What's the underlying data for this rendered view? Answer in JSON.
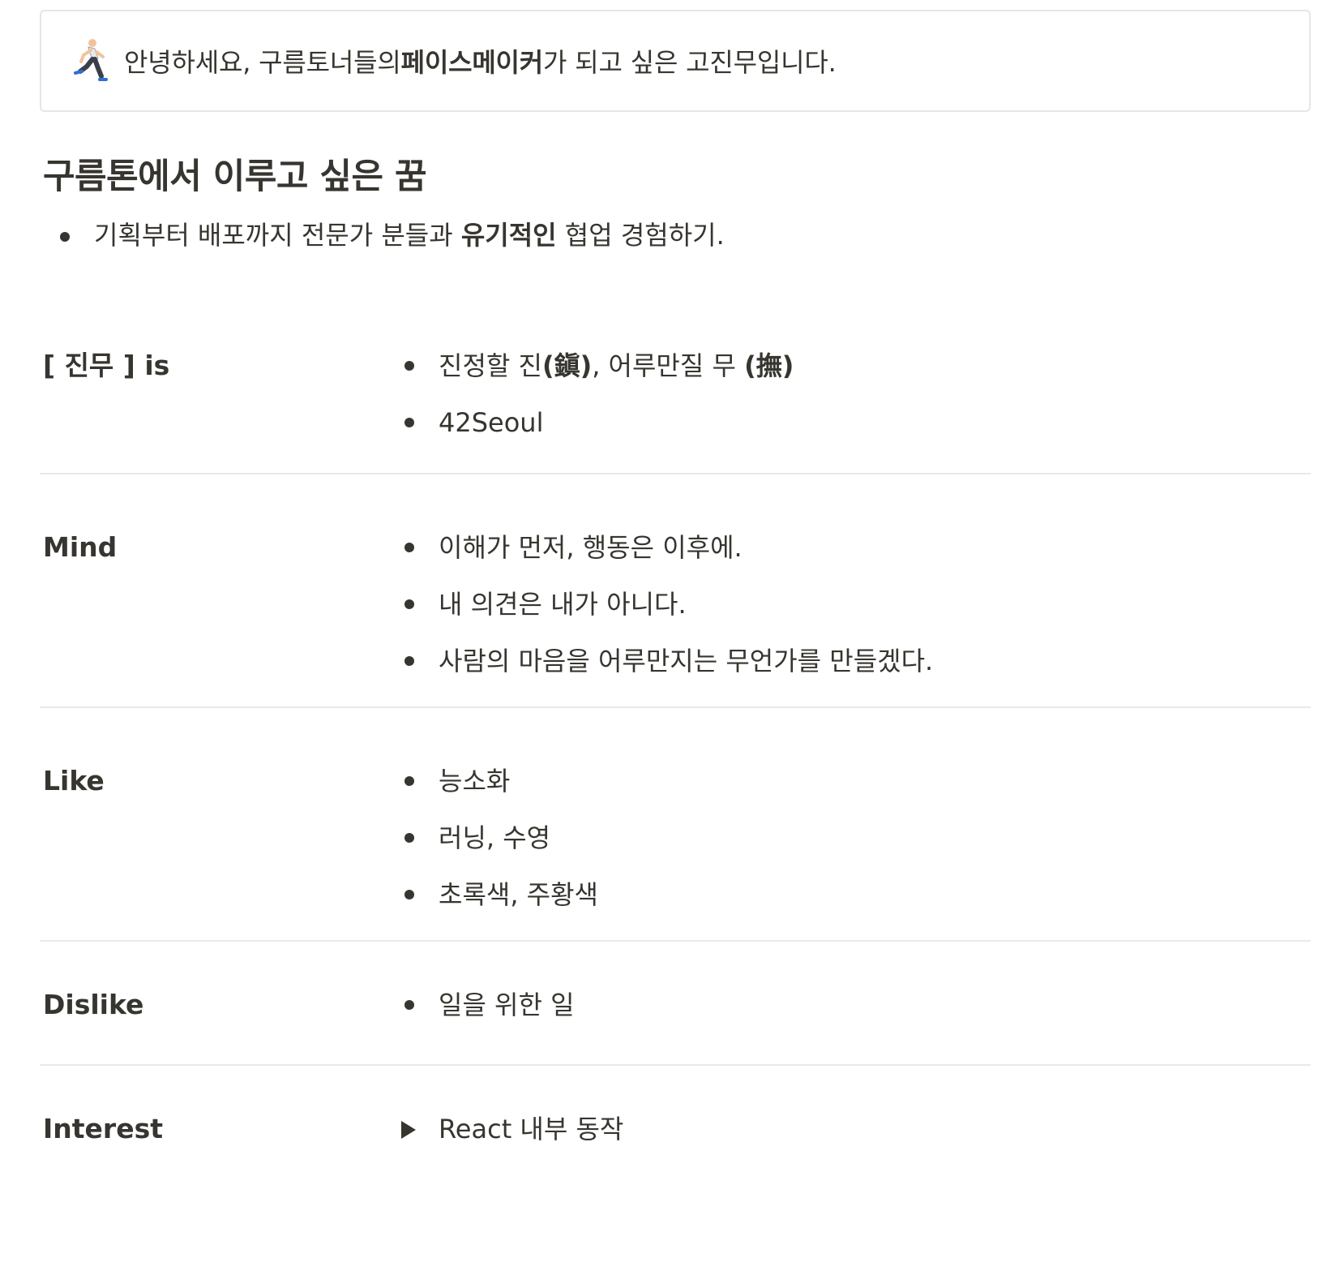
{
  "callout": {
    "icon": "runner-emoji-icon",
    "text_before": "안녕하세요, 구름토너들의 ",
    "text_bold": "페이스메이커",
    "text_after": "가 되고 싶은 고진무입니다."
  },
  "dream": {
    "heading": "구름톤에서 이루고 싶은 꿈",
    "item_before": "기획부터 배포까지 전문가 분들과 ",
    "item_bold": "유기적인",
    "item_after": " 협업 경험하기."
  },
  "profile": {
    "jinmu": {
      "label": "[  진무  ] is",
      "item1_a": "진정할 진",
      "item1_b": "(鎭)",
      "item1_c": ", 어루만질 무 ",
      "item1_d": "(撫)",
      "item2": "42Seoul"
    },
    "mind": {
      "label": "Mind",
      "items": [
        "이해가 먼저, 행동은 이후에.",
        "내 의견은 내가 아니다.",
        "사람의 마음을 어루만지는 무언가를 만들겠다."
      ]
    },
    "like": {
      "label": "Like",
      "items": [
        "능소화",
        "러닝, 수영",
        "초록색, 주황색"
      ]
    },
    "dislike": {
      "label": "Dislike",
      "items": [
        "일을 위한 일"
      ]
    },
    "interest": {
      "label": "Interest",
      "toggle": "React 내부 동작"
    }
  }
}
